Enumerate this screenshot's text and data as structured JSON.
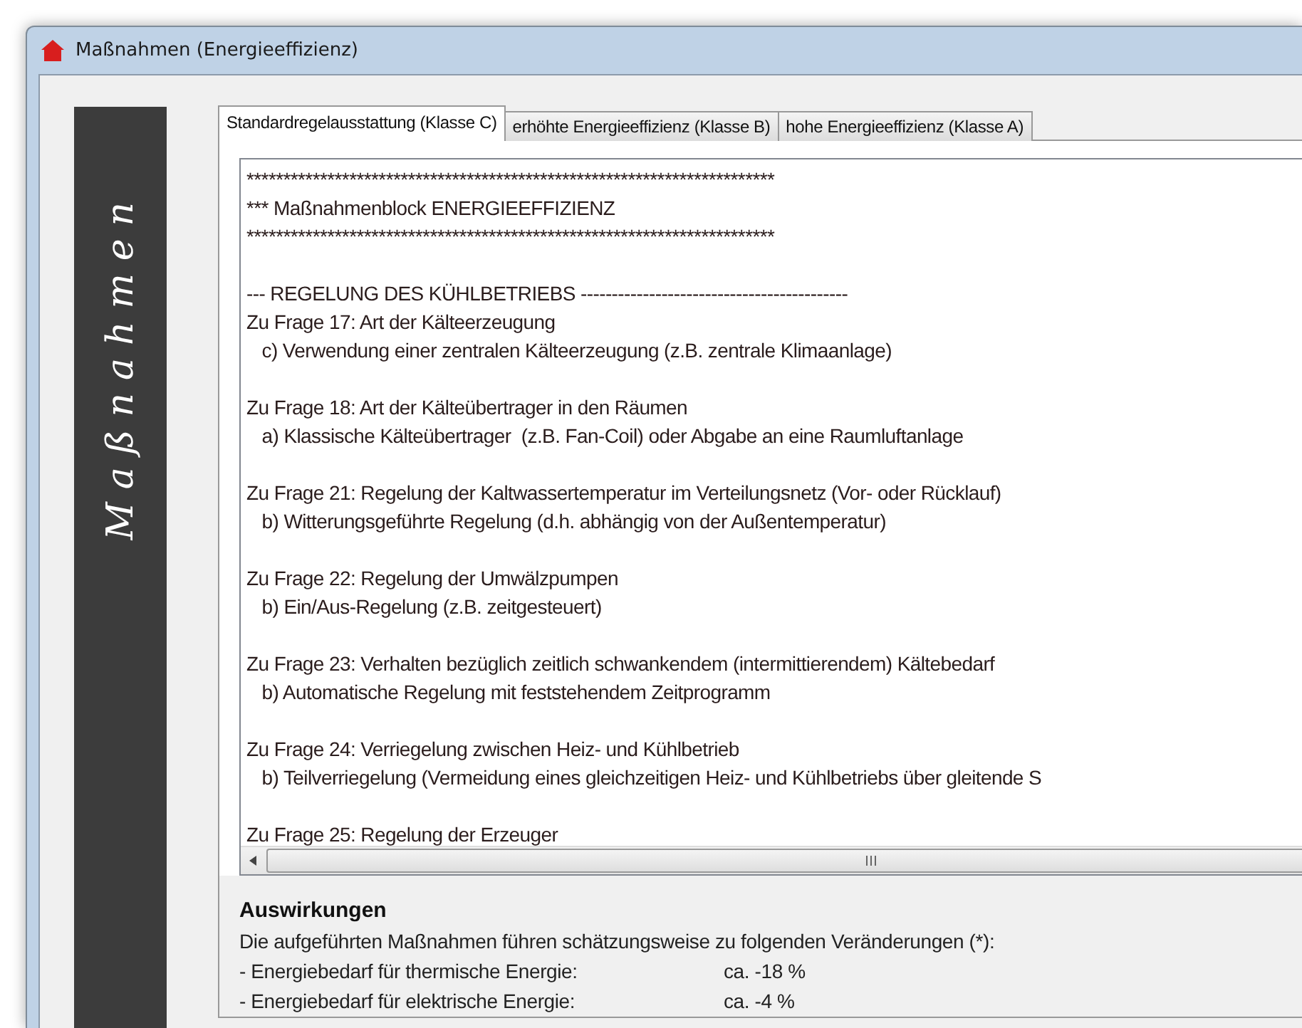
{
  "window": {
    "title": "Maßnahmen (Energieeffizienz)"
  },
  "sidebar": {
    "label": "Maßnahmen"
  },
  "tabs": [
    {
      "label": "Standardregelausstattung (Klasse C)",
      "selected": true
    },
    {
      "label": "erhöhte Energieeffizienz (Klasse B)",
      "selected": false
    },
    {
      "label": "hohe Energieeffizienz (Klasse A)",
      "selected": false
    }
  ],
  "report": {
    "blocks": [
      {
        "lines": [
          "************************************************************************",
          "*** Maßnahmenblock ENERGIEEFFIZIENZ",
          "************************************************************************"
        ]
      },
      {
        "lines": [
          "--- REGELUNG DES KÜHLBETRIEBS -------------------------------------------",
          "Zu Frage 17: Art der Kälteerzeugung",
          "   c) Verwendung einer zentralen Kälteerzeugung (z.B. zentrale Klimaanlage)"
        ]
      },
      {
        "lines": [
          "Zu Frage 18: Art der Kälteübertrager in den Räumen",
          "   a) Klassische Kälteübertrager  (z.B. Fan-Coil) oder Abgabe an eine Raumluftanlage"
        ]
      },
      {
        "lines": [
          "Zu Frage 21: Regelung der Kaltwassertemperatur im Verteilungsnetz (Vor- oder Rücklauf)",
          "   b) Witterungsgeführte Regelung (d.h. abhängig von der Außentemperatur)"
        ]
      },
      {
        "lines": [
          "Zu Frage 22: Regelung der Umwälzpumpen",
          "   b) Ein/Aus-Regelung (z.B. zeitgesteuert)"
        ]
      },
      {
        "lines": [
          "Zu Frage 23: Verhalten bezüglich zeitlich schwankendem (intermittierendem) Kältebedarf",
          "   b) Automatische Regelung mit feststehendem Zeitprogramm"
        ]
      },
      {
        "lines": [
          "Zu Frage 24: Verriegelung zwischen Heiz- und Kühlbetrieb",
          "   b) Teilverriegelung (Vermeidung eines gleichzeitigen Heiz- und Kühlbetriebs über gleitende S"
        ]
      },
      {
        "lines": [
          "Zu Frage 25: Regelung der Erzeuger"
        ]
      }
    ]
  },
  "effects": {
    "title": "Auswirkungen",
    "description": "Die aufgeführten Maßnahmen führen schätzungsweise zu folgenden Veränderungen (*):",
    "rows": [
      {
        "label": "- Energiebedarf für thermische Energie:",
        "value": "ca. -18 %"
      },
      {
        "label": "- Energiebedarf für elektrische Energie:",
        "value": "ca. -4 %"
      }
    ]
  }
}
